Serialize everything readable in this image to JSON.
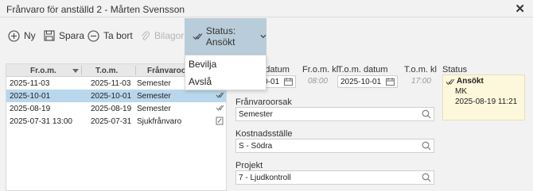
{
  "window": {
    "title": "Frånvaro för anställd 2 - Mårten Svensson",
    "close_icon": "close-icon"
  },
  "toolbar": {
    "new_label": "Ny",
    "save_label": "Spara",
    "delete_label": "Ta bort",
    "attachments_label": "Bilagor",
    "status_label": "Status: Ansökt"
  },
  "status_menu": {
    "options": [
      "Bevilja",
      "Avslå"
    ]
  },
  "grid": {
    "columns": [
      "Fr.o.m.",
      "T.o.m.",
      "Frånvaroorsak"
    ],
    "rows": [
      {
        "from": "2025-11-03",
        "to": "2025-11-03",
        "reason": "Semester",
        "icon": ""
      },
      {
        "from": "2025-10-01",
        "to": "2025-10-01",
        "reason": "Semester",
        "icon": "check-icon"
      },
      {
        "from": "2025-08-19",
        "to": "2025-08-19",
        "reason": "Semester",
        "icon": "check-icon"
      },
      {
        "from": "2025-07-31 13:00",
        "to": "2025-07-31",
        "reason": "Sjukfrånvaro",
        "icon": "edit-icon"
      }
    ],
    "selected_row": 1
  },
  "form": {
    "from_date_label": "Fr.o.m. datum",
    "from_date_value": "2025-10-01",
    "from_time_label": "Fr.o.m. kl",
    "from_time_placeholder": "08:00",
    "to_date_label": "T.o.m. datum",
    "to_date_value": "2025-10-01",
    "to_time_label": "T.o.m. kl",
    "to_time_placeholder": "17:00",
    "reason_label": "Frånvaroorsak",
    "reason_value": "Semester",
    "cost_center_label": "Kostnadsställe",
    "cost_center_value": "S - Södra",
    "project_label": "Projekt",
    "project_value": "7 - Ljudkontroll"
  },
  "status_panel": {
    "label": "Status",
    "state": "Ansökt",
    "by": "MK",
    "date": "2025-08-19 11:21"
  },
  "colors": {
    "selected_row": "#b9d7ec",
    "status_button": "#b9ccd9",
    "status_box": "#fdf8dc"
  }
}
